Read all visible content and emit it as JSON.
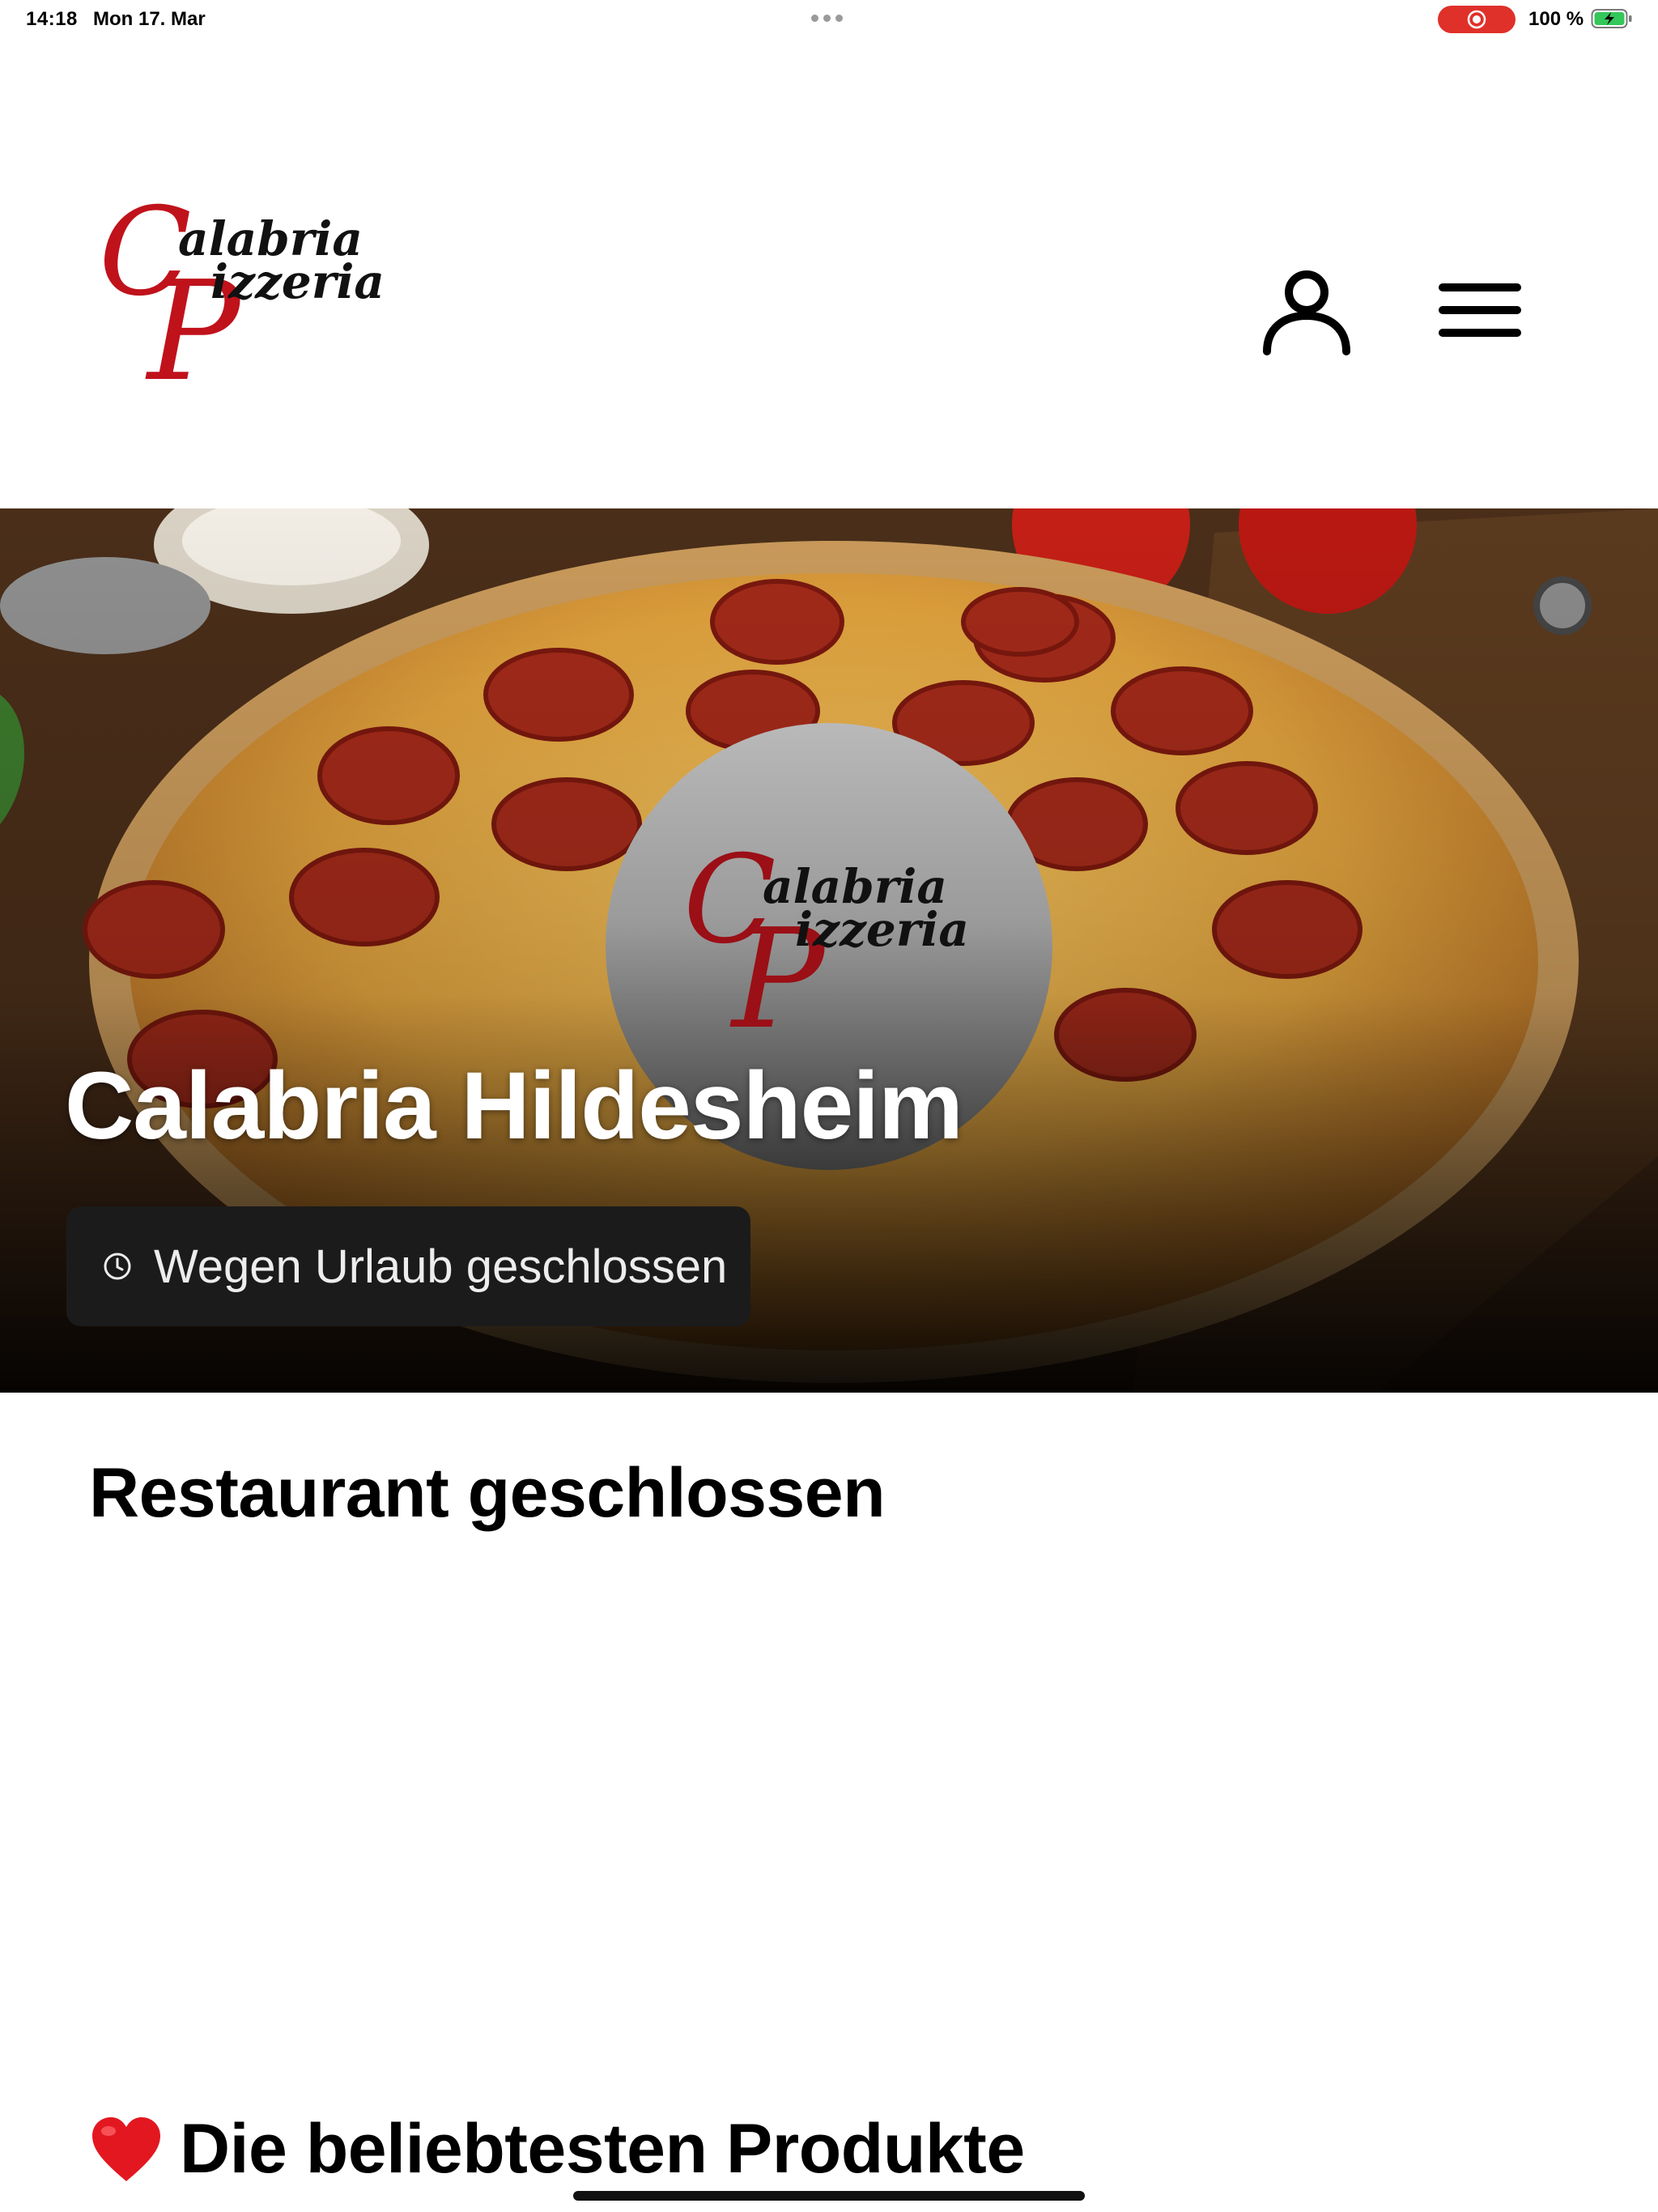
{
  "status_bar": {
    "time": "14:18",
    "date": "Mon 17. Mar",
    "battery_percent": "100 %",
    "recording_indicator_color": "#e0302a",
    "battery_color": "#34c759"
  },
  "header": {
    "logo_line1": "alabria",
    "logo_line2": "izzeria",
    "logo_initial1": "C",
    "logo_initial2": "P",
    "logo_color": "#c0121b",
    "user_icon": "user-icon",
    "menu_icon": "hamburger-menu-icon"
  },
  "hero": {
    "title": "Calabria Hildesheim",
    "status_text": "Wegen Urlaub geschlossen",
    "status_icon": "clock-icon"
  },
  "main": {
    "closed_heading": "Restaurant geschlossen",
    "popular_heading": "Die beliebtesten Produkte",
    "popular_icon": "heart-icon"
  }
}
